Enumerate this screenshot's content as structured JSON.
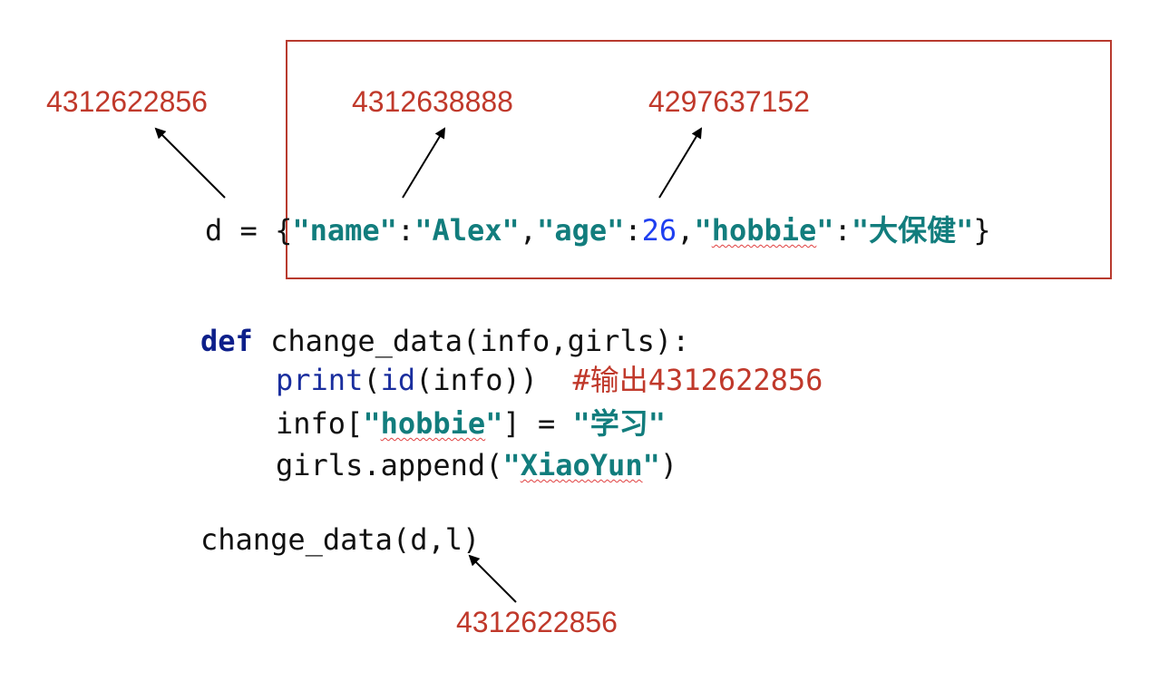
{
  "memory_labels": {
    "d_address": "4312622856",
    "name_value_address": "4312638888",
    "age_value_address": "4297637152",
    "l_address": "4312622856"
  },
  "code": {
    "dict_line": {
      "prefix": "d = {",
      "k1": "\"name\"",
      "colon1": ":",
      "v1": "\"Alex\"",
      "comma1": ",",
      "k2": "\"age\"",
      "colon2": ":",
      "v2": "26",
      "comma2": ",",
      "k3_q1": "\"",
      "k3": "hobbie",
      "k3_q2": "\"",
      "colon3": ":",
      "v3": "\"大保健\"",
      "suffix": "}"
    },
    "def_line": {
      "keyword": "def",
      "rest": " change_data(info,girls):"
    },
    "print_line": {
      "func": "print",
      "paren_open": "(",
      "id_func": "id",
      "args": "(info))  ",
      "comment": "#输出4312622856"
    },
    "assign_line": {
      "prefix": "info[",
      "q1": "\"",
      "key": "hobbie",
      "q2": "\"",
      "middle": "] = ",
      "value": "\"学习\""
    },
    "append_line": {
      "prefix": "girls.append(",
      "q1": "\"",
      "value": "XiaoYun",
      "q2": "\"",
      "suffix": ")"
    },
    "call_line": "change_data(d,l)"
  },
  "colors": {
    "annotation": "#c0392b",
    "box_border": "#b83a2e",
    "string": "#127d7d",
    "keyword": "#0d1f8a",
    "number": "#1f3ff0"
  }
}
